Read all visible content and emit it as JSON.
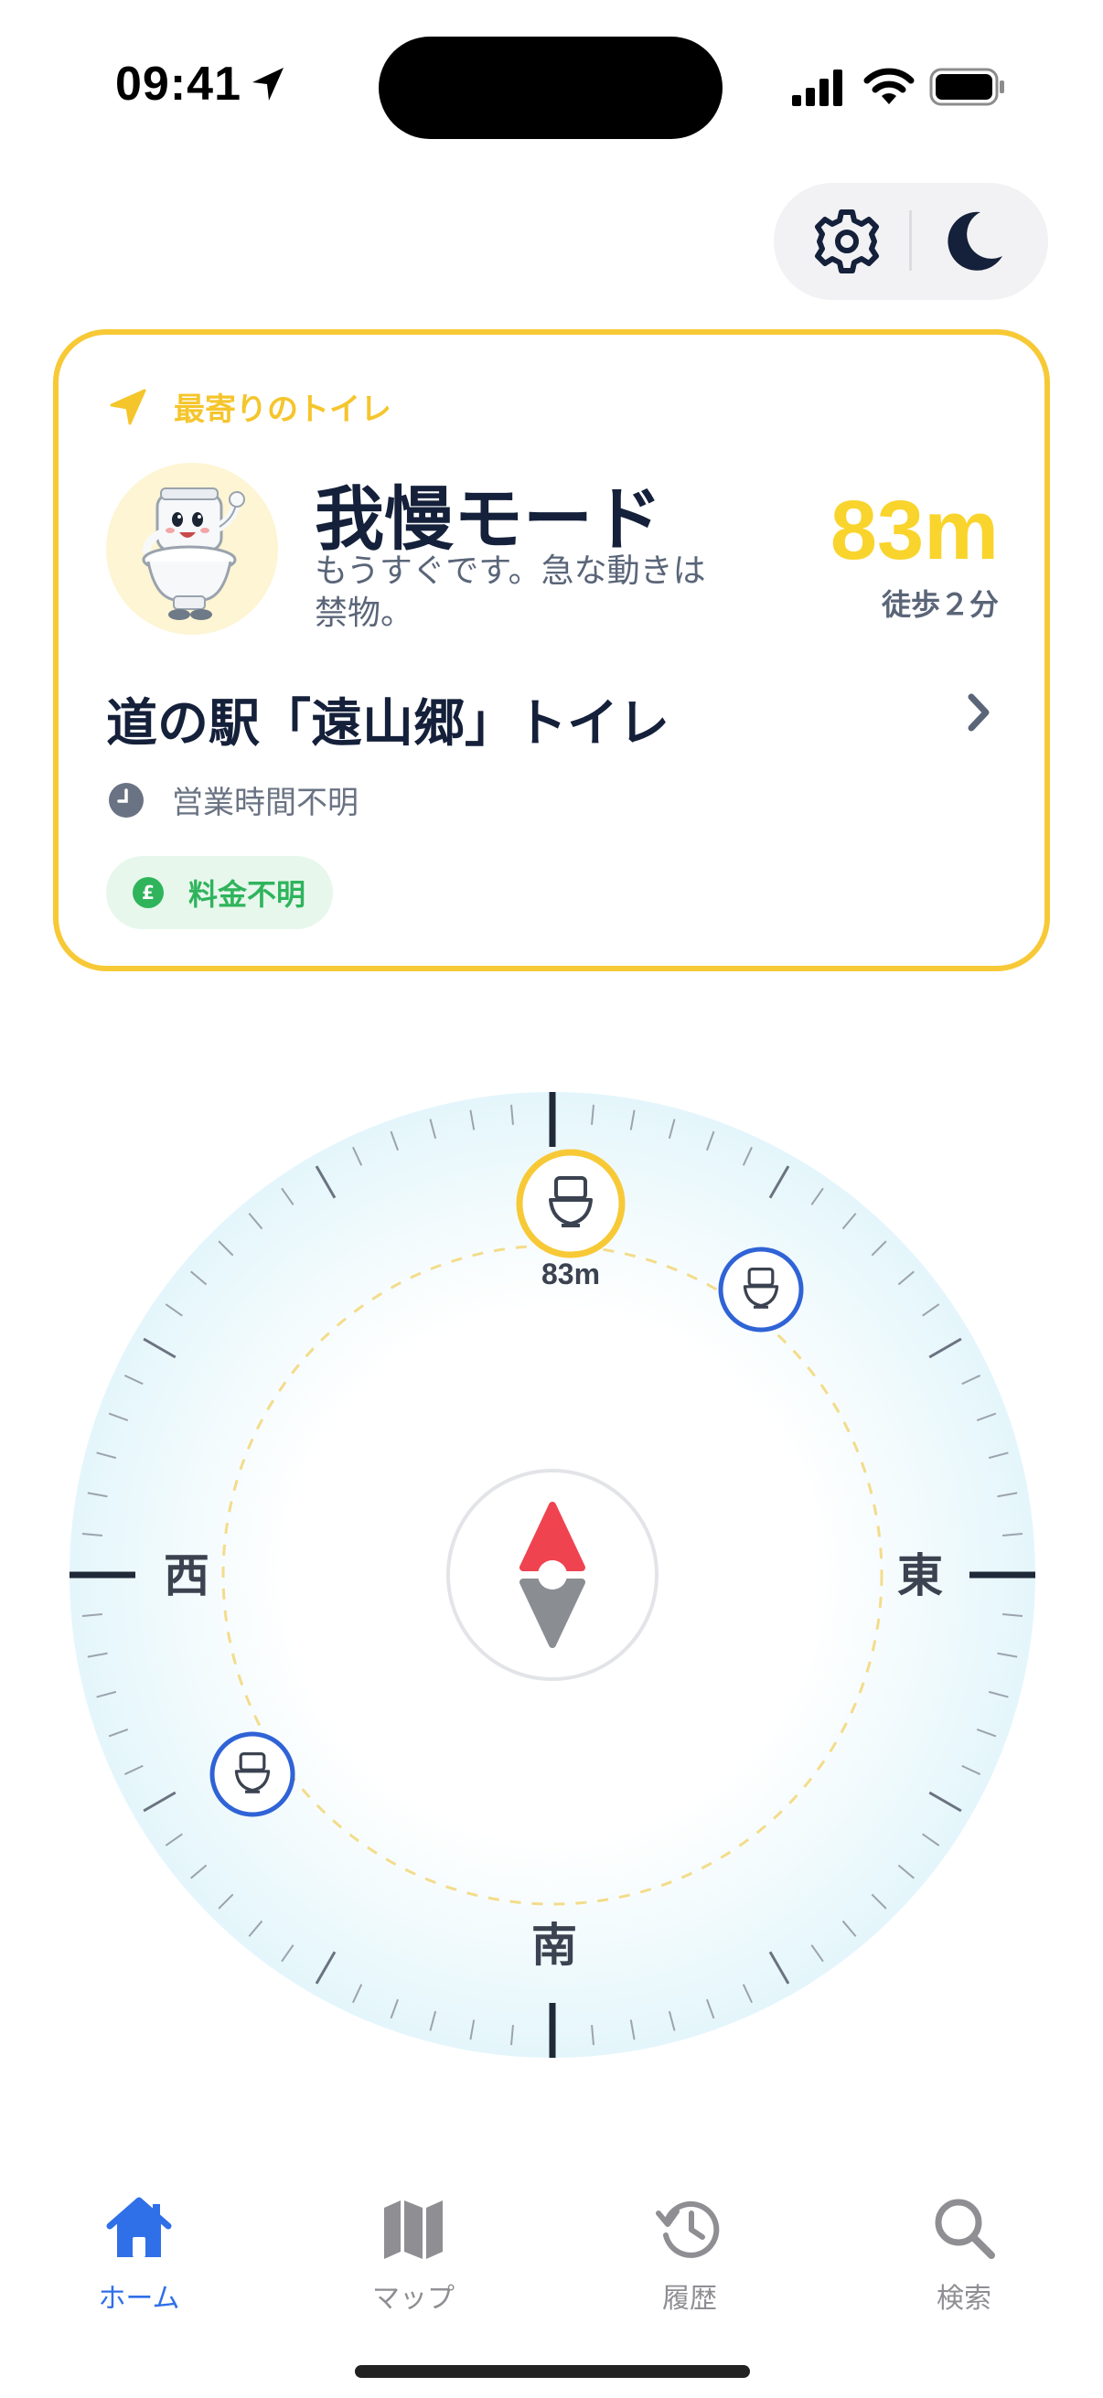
{
  "status_bar": {
    "time": "09:41",
    "icons": [
      "location-arrow-icon",
      "cellular-signal-icon",
      "wifi-icon",
      "battery-icon"
    ]
  },
  "top_controls": {
    "icons": [
      "gear-icon",
      "moon-icon"
    ]
  },
  "nearest": {
    "label": "最寄りのトイレ",
    "mode_title": "我慢モード",
    "mode_subtitle": "もうすぐです。急な動きは禁物。",
    "distance": "83m",
    "walk_time": "徒歩２分",
    "toilet_name": "道の駅「遠山郷」トイレ",
    "hours": "営業時間不明",
    "fee": "料金不明",
    "fee_icon_glyph": "£"
  },
  "compass": {
    "directions": {
      "west": "西",
      "east": "東",
      "south": "南"
    },
    "nearest_marker_distance": "83m",
    "accent_color": "#f7c936",
    "other_marker_color": "#2f63d6",
    "needle_north_color": "#f04350",
    "needle_south_color": "#8a8e93"
  },
  "tabs": [
    {
      "label": "ホーム",
      "icon": "home-icon",
      "active": true
    },
    {
      "label": "マップ",
      "icon": "map-icon",
      "active": false
    },
    {
      "label": "履歴",
      "icon": "history-icon",
      "active": false
    },
    {
      "label": "検索",
      "icon": "search-icon",
      "active": false
    }
  ],
  "colors": {
    "accent_yellow": "#f7c936",
    "tab_active": "#2f6fe8",
    "text_dark": "#15203a",
    "fee_green": "#2fb45c"
  }
}
